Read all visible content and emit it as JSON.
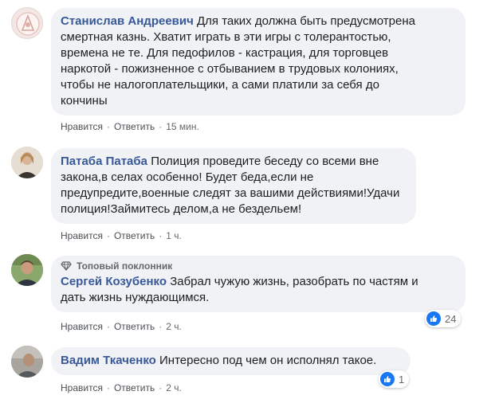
{
  "colors": {
    "author": "#385898",
    "bubble": "#f0f2f5",
    "meta": "#65676b",
    "like_blue": "#1877f2"
  },
  "comments": [
    {
      "author": "Станислав Андреевич",
      "lines": [
        "Для таких должна быть предусмотрена",
        "смертная казнь. Хватит играть в эти игры с толерантостью,",
        "времена не те. Для педофилов - кастрация, для торговцев",
        "наркотой - пожизненное с отбыванием в трудовых колониях,",
        "чтобы не налогоплательщики, а сами платили за себя до",
        "кончины"
      ],
      "like": "Нравится",
      "reply": "Ответить",
      "time": "15 мин."
    },
    {
      "author": "Патаба Патаба",
      "lines": [
        "Полиция проведите беседу со всеми вне",
        "закона,в селах особенно! Будет беда,если не",
        "предупредите,военные следят за вашими действиями!Удачи",
        "полиция!Займитесь делом,а не бездельем!"
      ],
      "like": "Нравится",
      "reply": "Ответить",
      "time": "1 ч."
    },
    {
      "badge": "Топовый поклонник",
      "badge_icon": "diamond-icon",
      "author": "Сергей Козубенко",
      "lines": [
        "Забрал чужую жизнь, разобрать по частям и",
        "дать жизнь нуждающимся."
      ],
      "like": "Нравится",
      "reply": "Ответить",
      "time": "2 ч.",
      "reaction_count": "24"
    },
    {
      "author": "Вадим Ткаченко",
      "lines": [
        "Интересно под чем он исполнял такое."
      ],
      "like": "Нравится",
      "reply": "Ответить",
      "time": "2 ч.",
      "reaction_count": "1"
    }
  ]
}
